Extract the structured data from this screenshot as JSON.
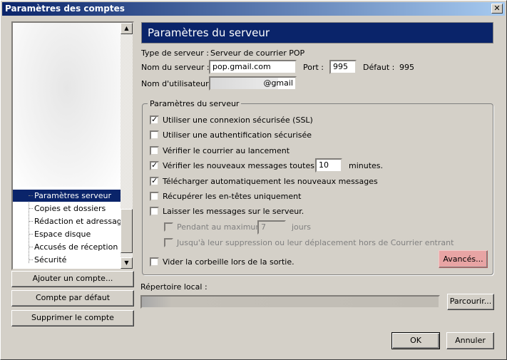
{
  "window": {
    "title": "Paramètres des comptes",
    "close": "✕"
  },
  "tree": {
    "items": [
      {
        "label": "Paramètres serveur",
        "selected": true
      },
      {
        "label": "Copies et dossiers"
      },
      {
        "label": "Rédaction et adressage"
      },
      {
        "label": "Espace disque"
      },
      {
        "label": "Accusés de réception"
      },
      {
        "label": "Sécurité"
      }
    ]
  },
  "left_buttons": {
    "add": "Ajouter un compte...",
    "default": "Compte par défaut",
    "delete": "Supprimer le compte"
  },
  "panel": {
    "title": "Paramètres du serveur",
    "server_type_label": "Type de serveur :",
    "server_type": "Serveur de courrier POP",
    "server_name_label": "Nom du serveur :",
    "server_name": "pop.gmail.com",
    "port_label": "Port :",
    "port": "995",
    "default_label": "Défaut :",
    "default_port": "995",
    "username_label": "Nom d'utilisateur :",
    "username": "@gmail",
    "group_label": "Paramètres du serveur",
    "options": [
      {
        "label": "Utiliser une connexion sécurisée (SSL)",
        "checked": true
      },
      {
        "label": "Utiliser une authentification sécurisée",
        "checked": false
      },
      {
        "label": "Vérifier le courrier au lancement",
        "checked": false
      },
      {
        "label": "Vérifier les nouveaux messages toutes les",
        "checked": true,
        "value": "10",
        "suffix": "minutes."
      },
      {
        "label": "Télécharger automatiquement les nouveaux messages",
        "checked": true
      },
      {
        "label": "Récupérer les en-têtes uniquement",
        "checked": false
      },
      {
        "label": "Laisser les messages sur le serveur.",
        "checked": false
      },
      {
        "label": "Pendant au maximum",
        "checked": false,
        "disabled": true,
        "value": "7",
        "suffix": "jours"
      },
      {
        "label": "Jusqu'à leur suppression ou leur déplacement hors de Courrier entrant",
        "checked": false,
        "disabled": true
      },
      {
        "label": "Vider la corbeille lors de la sortie.",
        "checked": false
      }
    ],
    "advanced": "Avancés...",
    "local_dir_label": "Répertoire local :",
    "browse": "Parcourir..."
  },
  "footer": {
    "ok": "OK",
    "cancel": "Annuler"
  },
  "colors": {
    "titlebar": "#0a246a",
    "dialog_bg": "#d4d0c8",
    "highlight_button": "#e8a4a4"
  }
}
